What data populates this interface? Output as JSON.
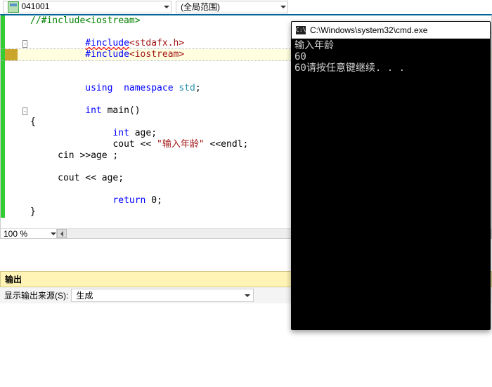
{
  "toolbar": {
    "combo1": "041001",
    "combo2": "(全局范围)"
  },
  "code": {
    "l1_comment": "//#include<iostream>",
    "l3_a": "#include",
    "l3_b": "<stdafx.h>",
    "l4_a": "#include",
    "l4_b": "<iostream>",
    "l7_a": "using",
    "l7_b": "  namespace ",
    "l7_c": "std",
    "l7_d": ";",
    "l9_a": "int",
    "l9_b": " main()",
    "l10": "{",
    "l11_a": "int",
    "l11_b": " age;",
    "l12_a": "     cout ",
    "l12_b": "<<",
    "l12_c": " \"输入年龄\"",
    "l12_d": " <<endl;",
    "l13": "     cin >>age ;",
    "l15": "     cout << age;",
    "l17_a": "     ",
    "l17_b": "return",
    "l17_c": " 0;",
    "l18": "}"
  },
  "zoom": "100 %",
  "output": {
    "title": "输出",
    "label": "显示输出来源(S):",
    "source": "生成"
  },
  "cmd": {
    "title": "C:\\Windows\\system32\\cmd.exe",
    "icon": "C:\\",
    "line1": "输入年龄",
    "line2": "60",
    "line3": "60请按任意键继续. . ."
  }
}
